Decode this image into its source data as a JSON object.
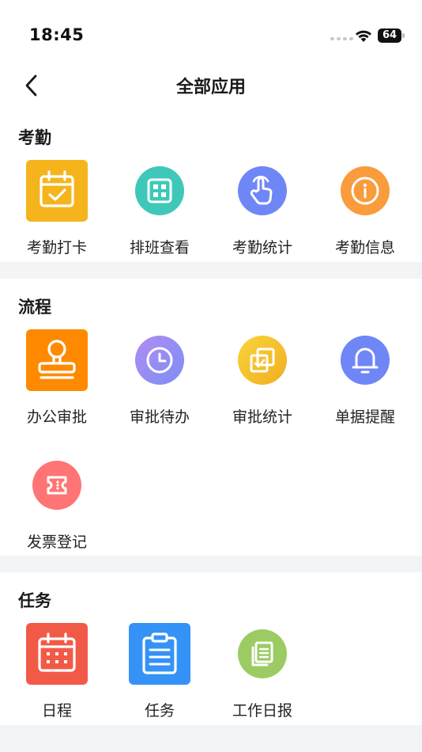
{
  "status_bar": {
    "time": "18:45",
    "battery": "64"
  },
  "nav": {
    "title": "全部应用"
  },
  "sections": [
    {
      "title": "考勤",
      "apps": [
        {
          "label": "考勤打卡",
          "icon": "calendar-check-icon",
          "color": "#F5B41C"
        },
        {
          "label": "排班查看",
          "icon": "grid-icon",
          "color": "#3FC8B9"
        },
        {
          "label": "考勤统计",
          "icon": "pointer-hand-icon",
          "color": "#6F86F6"
        },
        {
          "label": "考勤信息",
          "icon": "info-icon",
          "color": "#FA9B3C"
        }
      ]
    },
    {
      "title": "流程",
      "apps": [
        {
          "label": "办公审批",
          "icon": "stamp-icon",
          "color": "#FF8A00"
        },
        {
          "label": "审批待办",
          "icon": "clock-icon",
          "color": "#9C8BF0"
        },
        {
          "label": "审批统计",
          "icon": "copy-check-icon",
          "color": "#F5C02A"
        },
        {
          "label": "单据提醒",
          "icon": "bell-icon",
          "color": "#6F86F6"
        },
        {
          "label": "发票登记",
          "icon": "ticket-icon",
          "color": "#FF7474"
        }
      ]
    },
    {
      "title": "任务",
      "apps": [
        {
          "label": "日程",
          "icon": "calendar-icon",
          "color": "#F25A48"
        },
        {
          "label": "任务",
          "icon": "clipboard-icon",
          "color": "#3592F7"
        },
        {
          "label": "工作日报",
          "icon": "documents-icon",
          "color": "#9BCB62"
        }
      ]
    }
  ]
}
